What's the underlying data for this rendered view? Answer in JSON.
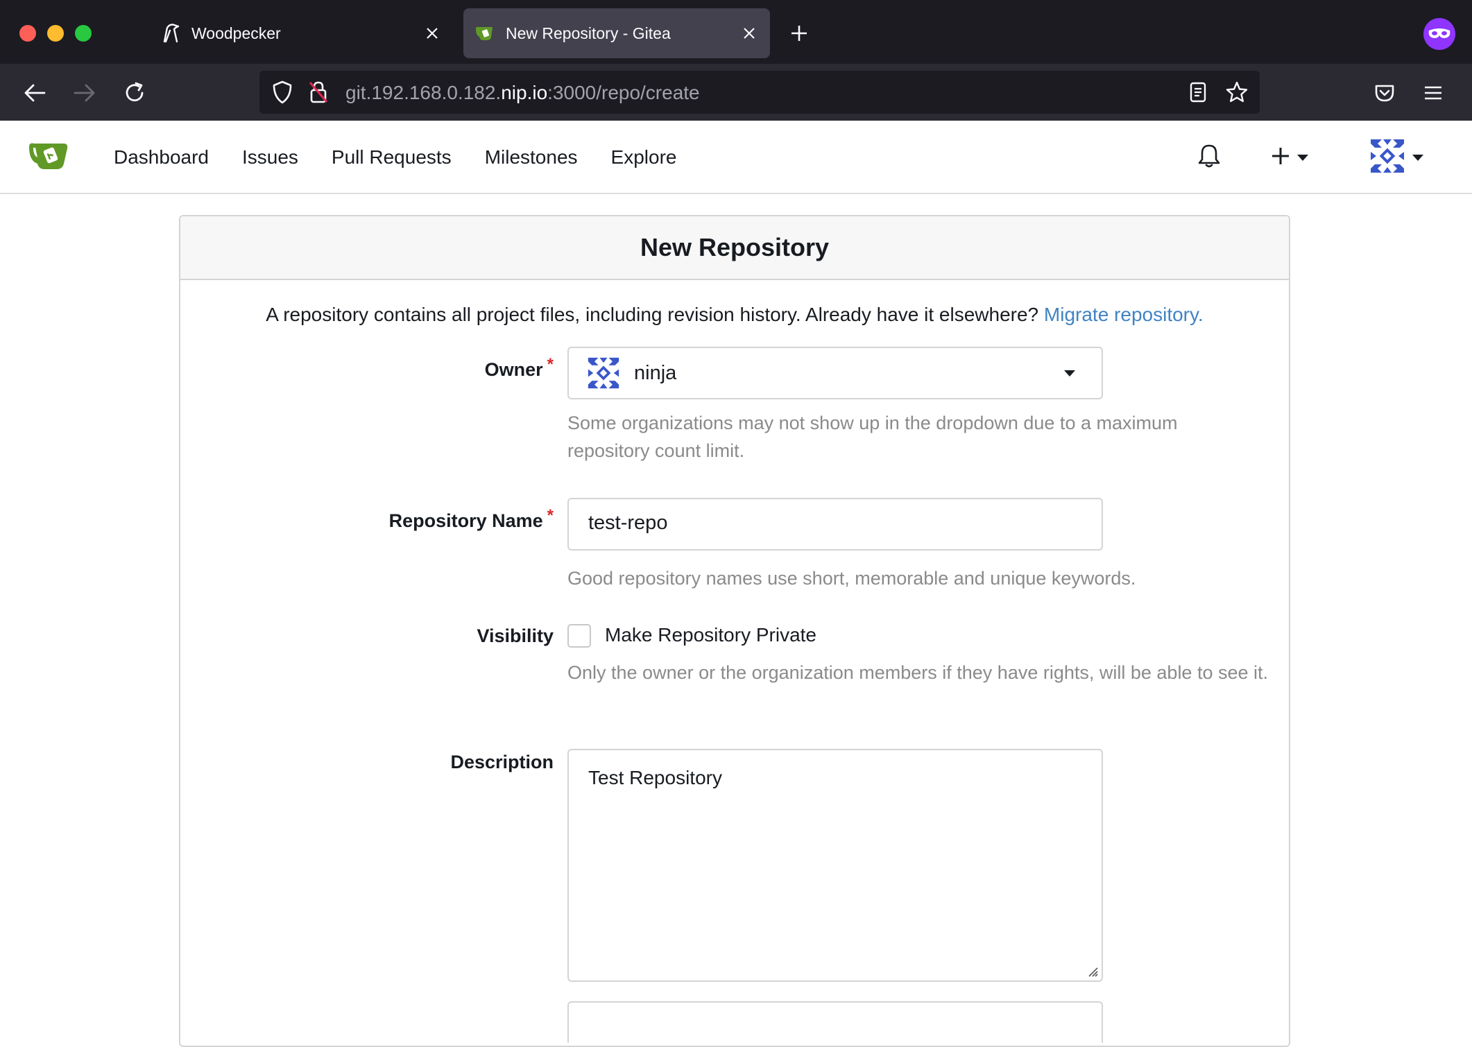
{
  "browser": {
    "tabs": [
      {
        "title": "Woodpecker",
        "icon": "woodpecker-icon",
        "active": false
      },
      {
        "title": "New Repository - Gitea",
        "icon": "gitea-icon",
        "active": true
      }
    ],
    "url": {
      "prefix": "git.192.168.0.182.",
      "domain": "nip.io",
      "suffix": ":3000/repo/create"
    }
  },
  "header": {
    "nav": {
      "dashboard": "Dashboard",
      "issues": "Issues",
      "pull_requests": "Pull Requests",
      "milestones": "Milestones",
      "explore": "Explore"
    }
  },
  "form": {
    "title": "New Repository",
    "intro": "A repository contains all project files, including revision history. Already have it elsewhere?",
    "migrate_link": "Migrate repository.",
    "owner": {
      "label": "Owner",
      "required_mark": "*",
      "value": "ninja",
      "help": "Some organizations may not show up in the dropdown due to a maximum repository count limit."
    },
    "repo_name": {
      "label": "Repository Name",
      "required_mark": "*",
      "value": "test-repo",
      "help": "Good repository names use short, memorable and unique keywords."
    },
    "visibility": {
      "label": "Visibility",
      "checkbox_label": "Make Repository Private",
      "checked": false,
      "help": "Only the owner or the organization members if they have rights, will be able to see it."
    },
    "description": {
      "label": "Description",
      "value": "Test Repository"
    }
  },
  "colors": {
    "link": "#4183c4",
    "required": "#db2828",
    "gitea_green": "#609926",
    "browser_bg": "#1c1b22"
  }
}
